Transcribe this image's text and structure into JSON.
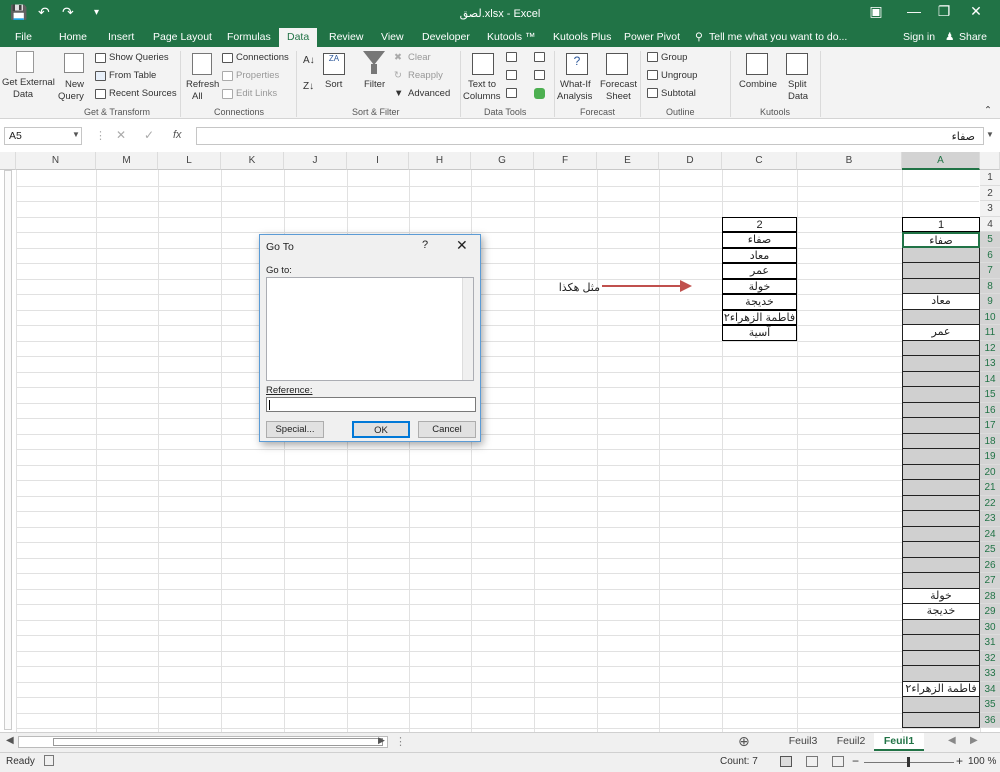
{
  "window": {
    "title": "لصق.xlsx - Excel"
  },
  "tabs": [
    "File",
    "Home",
    "Insert",
    "Page Layout",
    "Formulas",
    "Data",
    "Review",
    "View",
    "Developer",
    "Kutools ™",
    "Kutools Plus",
    "Power Pivot"
  ],
  "tell_me": "Tell me what you want to do...",
  "signin": "Sign in",
  "share": "Share",
  "ribbon": {
    "get_external": "Get External",
    "data_label": "Data",
    "new": "New",
    "query": "Query",
    "show_queries": "Show Queries",
    "from_table": "From Table",
    "recent_sources": "Recent Sources",
    "refresh": "Refresh",
    "all": "All",
    "connections": "Connections",
    "properties": "Properties",
    "edit_links": "Edit Links",
    "sort": "Sort",
    "filter": "Filter",
    "clear": "Clear",
    "reapply": "Reapply",
    "advanced": "Advanced",
    "text_to": "Text to",
    "columns": "Columns",
    "what_if": "What-If",
    "analysis": "Analysis",
    "forecast": "Forecast",
    "sheet": "Sheet",
    "group": "Group",
    "ungroup": "Ungroup",
    "subtotal": "Subtotal",
    "combine": "Combine",
    "split": "Split",
    "data2": "Data",
    "groups": {
      "gt": "Get & Transform",
      "conn": "Connections",
      "sf": "Sort & Filter",
      "dt": "Data Tools",
      "fc": "Forecast",
      "ol": "Outline",
      "ku": "Kutools"
    }
  },
  "namebox": "A5",
  "fx": "fx",
  "formula": "صفاء",
  "columns": [
    "N",
    "M",
    "L",
    "K",
    "J",
    "I",
    "H",
    "G",
    "F",
    "E",
    "D",
    "C",
    "B",
    "A"
  ],
  "rows": [
    "1",
    "2",
    "3",
    "4",
    "5",
    "6",
    "7",
    "8",
    "9",
    "10",
    "11",
    "12",
    "13",
    "14",
    "15",
    "16",
    "17",
    "18",
    "19",
    "20",
    "21",
    "22",
    "23",
    "24",
    "25",
    "26",
    "27",
    "28",
    "29",
    "30",
    "31",
    "32",
    "33",
    "34",
    "35",
    "36"
  ],
  "col_c": [
    "2",
    "صفاء",
    "معاد",
    "عمر",
    "خولة",
    "خديجة",
    "فاطمة الزهراء٢",
    "آسية"
  ],
  "col_a": {
    "r4": "1",
    "r5": "صفاء",
    "r9": "معاد",
    "r11": "عمر",
    "r28": "خولة",
    "r29": "خديجة",
    "r34": "فاطمة الزهراء٢"
  },
  "annotation": "مثل هكذا",
  "dialog": {
    "title": "Go To",
    "help": "?",
    "goto": "Go to:",
    "reference": "Reference:",
    "special": "Special...",
    "ok": "OK",
    "cancel": "Cancel"
  },
  "sheets": [
    "Feuil3",
    "Feuil2",
    "Feuil1"
  ],
  "status": {
    "ready": "Ready",
    "count": "Count: 7",
    "zoom": "100 %"
  }
}
